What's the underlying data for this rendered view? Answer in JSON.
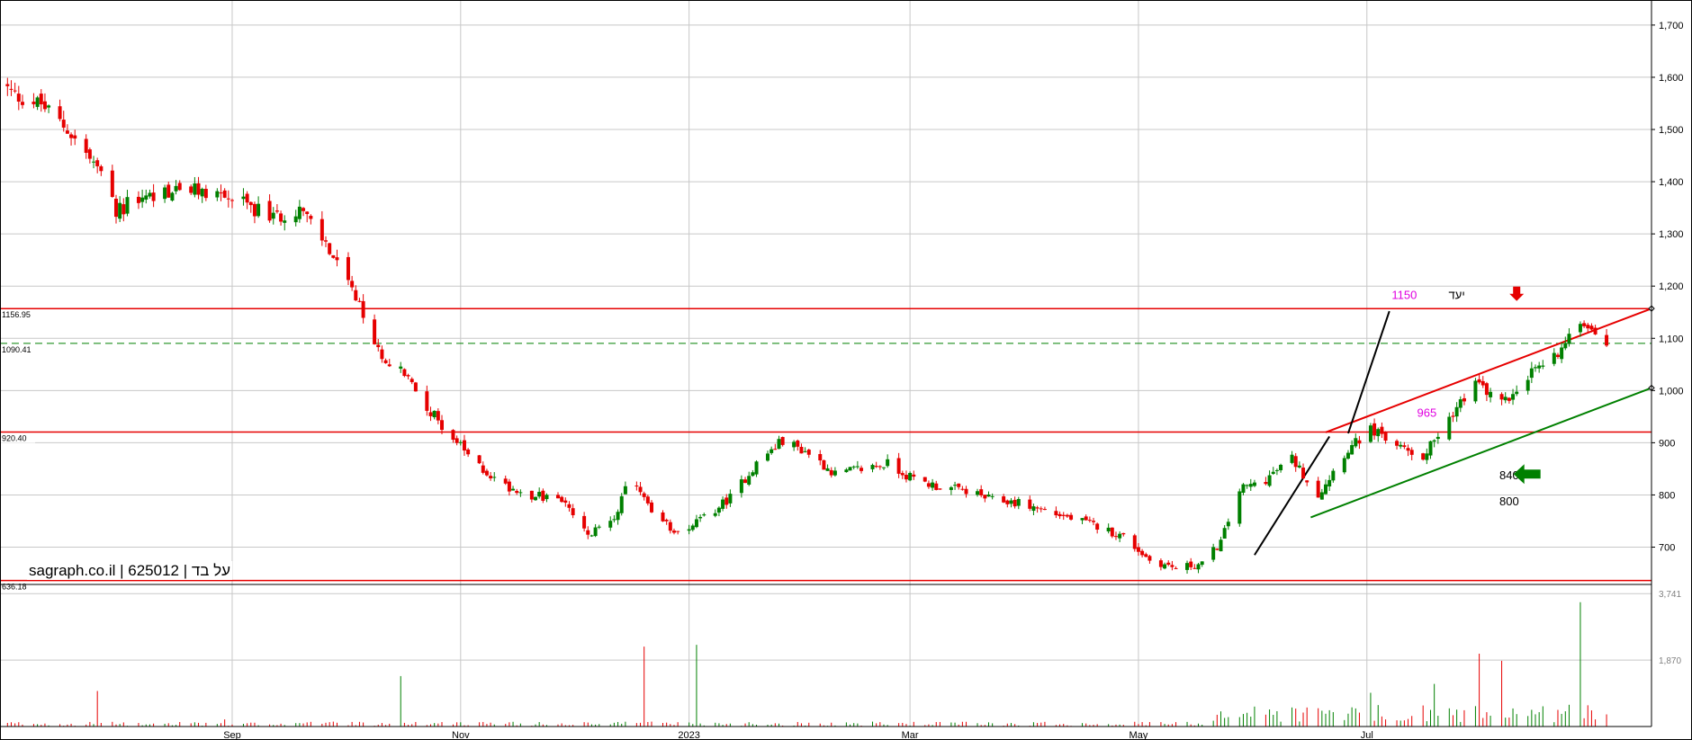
{
  "chart_data": {
    "type": "candlestick",
    "title": "sagraph.co.il | 625012 | על בד",
    "price_axis": {
      "min": 632,
      "max": 1748,
      "ticks": [
        700,
        800,
        900,
        1000,
        1100,
        1200,
        1300,
        1400,
        1500,
        1600,
        1700
      ],
      "tick_labels": [
        "700",
        "800",
        "900",
        "1,000",
        "1,100",
        "1,200",
        "1,300",
        "1,400",
        "1,500",
        "1,600",
        "1,700"
      ]
    },
    "volume_axis": {
      "min": 0,
      "max": 4000,
      "ticks": [
        1870,
        3741
      ],
      "tick_labels": [
        "1,870",
        "3,741"
      ]
    },
    "x_axis": {
      "start": "2022-07-01",
      "end": "2023-09-15",
      "labels": [
        {
          "date": "2022-09-01",
          "text": "Sep"
        },
        {
          "date": "2022-11-01",
          "text": "Nov"
        },
        {
          "date": "2023-01-01",
          "text": "2023"
        },
        {
          "date": "2023-03-01",
          "text": "Mar"
        },
        {
          "date": "2023-05-01",
          "text": "May"
        },
        {
          "date": "2023-07-01",
          "text": "Jul"
        }
      ]
    },
    "anchors": [
      [
        "2022-07-01",
        1590
      ],
      [
        "2022-07-05",
        1565
      ],
      [
        "2022-07-12",
        1548
      ],
      [
        "2022-07-19",
        1500
      ],
      [
        "2022-07-26",
        1435
      ],
      [
        "2022-08-01",
        1345
      ],
      [
        "2022-08-08",
        1370
      ],
      [
        "2022-08-18",
        1385
      ],
      [
        "2022-08-28",
        1378
      ],
      [
        "2022-09-05",
        1355
      ],
      [
        "2022-09-12",
        1330
      ],
      [
        "2022-09-19",
        1350
      ],
      [
        "2022-09-26",
        1280
      ],
      [
        "2022-10-03",
        1190
      ],
      [
        "2022-10-10",
        1075
      ],
      [
        "2022-10-17",
        1030
      ],
      [
        "2022-10-24",
        960
      ],
      [
        "2022-10-31",
        900
      ],
      [
        "2022-11-05",
        860
      ],
      [
        "2022-11-12",
        820
      ],
      [
        "2022-11-20",
        800
      ],
      [
        "2022-11-28",
        790
      ],
      [
        "2022-12-05",
        720
      ],
      [
        "2022-12-12",
        760
      ],
      [
        "2022-12-17",
        840
      ],
      [
        "2022-12-22",
        760
      ],
      [
        "2022-12-29",
        730
      ],
      [
        "2023-01-05",
        755
      ],
      [
        "2023-01-12",
        795
      ],
      [
        "2023-01-19",
        860
      ],
      [
        "2023-01-26",
        905
      ],
      [
        "2023-02-02",
        880
      ],
      [
        "2023-02-09",
        840
      ],
      [
        "2023-02-16",
        850
      ],
      [
        "2023-02-23",
        860
      ],
      [
        "2023-03-02",
        830
      ],
      [
        "2023-03-09",
        815
      ],
      [
        "2023-03-16",
        808
      ],
      [
        "2023-03-23",
        790
      ],
      [
        "2023-03-30",
        785
      ],
      [
        "2023-04-06",
        770
      ],
      [
        "2023-04-13",
        755
      ],
      [
        "2023-04-20",
        740
      ],
      [
        "2023-04-27",
        720
      ],
      [
        "2023-05-04",
        675
      ],
      [
        "2023-05-11",
        660
      ],
      [
        "2023-05-18",
        668
      ],
      [
        "2023-05-23",
        710
      ],
      [
        "2023-05-28",
        810
      ],
      [
        "2023-06-04",
        830
      ],
      [
        "2023-06-11",
        870
      ],
      [
        "2023-06-18",
        800
      ],
      [
        "2023-06-25",
        880
      ],
      [
        "2023-07-02",
        925
      ],
      [
        "2023-07-09",
        895
      ],
      [
        "2023-07-16",
        875
      ],
      [
        "2023-07-23",
        950
      ],
      [
        "2023-07-30",
        1015
      ],
      [
        "2023-08-06",
        975
      ],
      [
        "2023-08-13",
        1030
      ],
      [
        "2023-08-20",
        1065
      ],
      [
        "2023-08-27",
        1140
      ],
      [
        "2023-09-03",
        1095
      ]
    ],
    "volume_spikes": [
      [
        "2022-07-27",
        1000
      ],
      [
        "2022-08-30",
        200
      ],
      [
        "2022-10-16",
        1420
      ],
      [
        "2022-12-20",
        2250
      ],
      [
        "2023-01-03",
        2300
      ],
      [
        "2023-05-27",
        3741
      ],
      [
        "2023-07-02",
        950
      ],
      [
        "2023-07-19",
        1200
      ],
      [
        "2023-07-31",
        2050
      ],
      [
        "2023-08-06",
        1850
      ],
      [
        "2023-08-27",
        3500
      ],
      [
        "2023-09-01",
        1200
      ]
    ],
    "levels": [
      {
        "value": 1156.95,
        "label": "1156.95",
        "style": "solid",
        "color": "#e60000"
      },
      {
        "value": 1090.41,
        "label": "1090.41",
        "style": "dashed",
        "color": "#008000"
      },
      {
        "value": 920.4,
        "label": "920.40",
        "style": "solid",
        "color": "#e60000"
      },
      {
        "value": 636.18,
        "label": "636.18",
        "style": "solid",
        "color": "#e60000"
      }
    ],
    "trendlines": [
      {
        "from": [
          "2023-06-20",
          920
        ],
        "to": [
          "2023-09-15",
          1157
        ],
        "color": "#e60000"
      },
      {
        "from": [
          "2023-06-16",
          757
        ],
        "to": [
          "2023-09-15",
          1005
        ],
        "color": "#008000"
      },
      {
        "from": [
          "2023-06-01",
          685
        ],
        "to": [
          "2023-06-21",
          912
        ],
        "color": "#000000"
      },
      {
        "from": [
          "2023-06-26",
          918
        ],
        "to": [
          "2023-07-07",
          1152
        ],
        "color": "#000000"
      }
    ],
    "annotations": [
      {
        "text": "1150",
        "date": "2023-07-11",
        "price": 1175,
        "color": "#e000e0"
      },
      {
        "text": "יעד",
        "date": "2023-07-25",
        "price": 1175,
        "color": "#000000"
      },
      {
        "text": "965",
        "date": "2023-07-17",
        "price": 950,
        "color": "#e000e0"
      },
      {
        "text": "840",
        "date": "2023-08-08",
        "price": 830,
        "color": "#000000"
      },
      {
        "text": "800",
        "date": "2023-08-08",
        "price": 780,
        "color": "#000000"
      }
    ],
    "markers": [
      {
        "type": "down-arrow",
        "date": "2023-08-10",
        "price": 1175,
        "color": "#e60000"
      },
      {
        "type": "left-arrow",
        "date": "2023-08-13",
        "price": 840,
        "color": "#008000"
      }
    ]
  }
}
